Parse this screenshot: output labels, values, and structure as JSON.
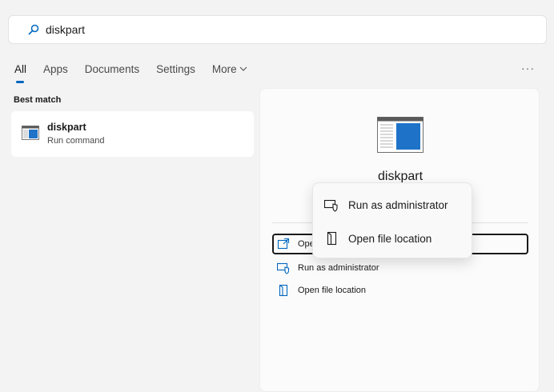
{
  "search": {
    "value": "diskpart"
  },
  "tabs": [
    {
      "label": "All",
      "active": true
    },
    {
      "label": "Apps"
    },
    {
      "label": "Documents"
    },
    {
      "label": "Settings"
    },
    {
      "label": "More"
    }
  ],
  "more_options": "···",
  "best_match": {
    "label": "Best match",
    "item": {
      "title": "diskpart",
      "subtitle": "Run command"
    }
  },
  "preview": {
    "title": "diskpart",
    "actions": [
      {
        "label": "Open",
        "icon": "open-icon"
      },
      {
        "label": "Run as administrator",
        "icon": "shield-admin-icon"
      },
      {
        "label": "Open file location",
        "icon": "folder-location-icon"
      }
    ]
  },
  "context_menu": {
    "items": [
      {
        "label": "Run as administrator",
        "icon": "shield-admin-icon"
      },
      {
        "label": "Open file location",
        "icon": "folder-location-icon"
      }
    ]
  },
  "colors": {
    "accent": "#0067c0",
    "icon_blue": "#1e73c8"
  }
}
